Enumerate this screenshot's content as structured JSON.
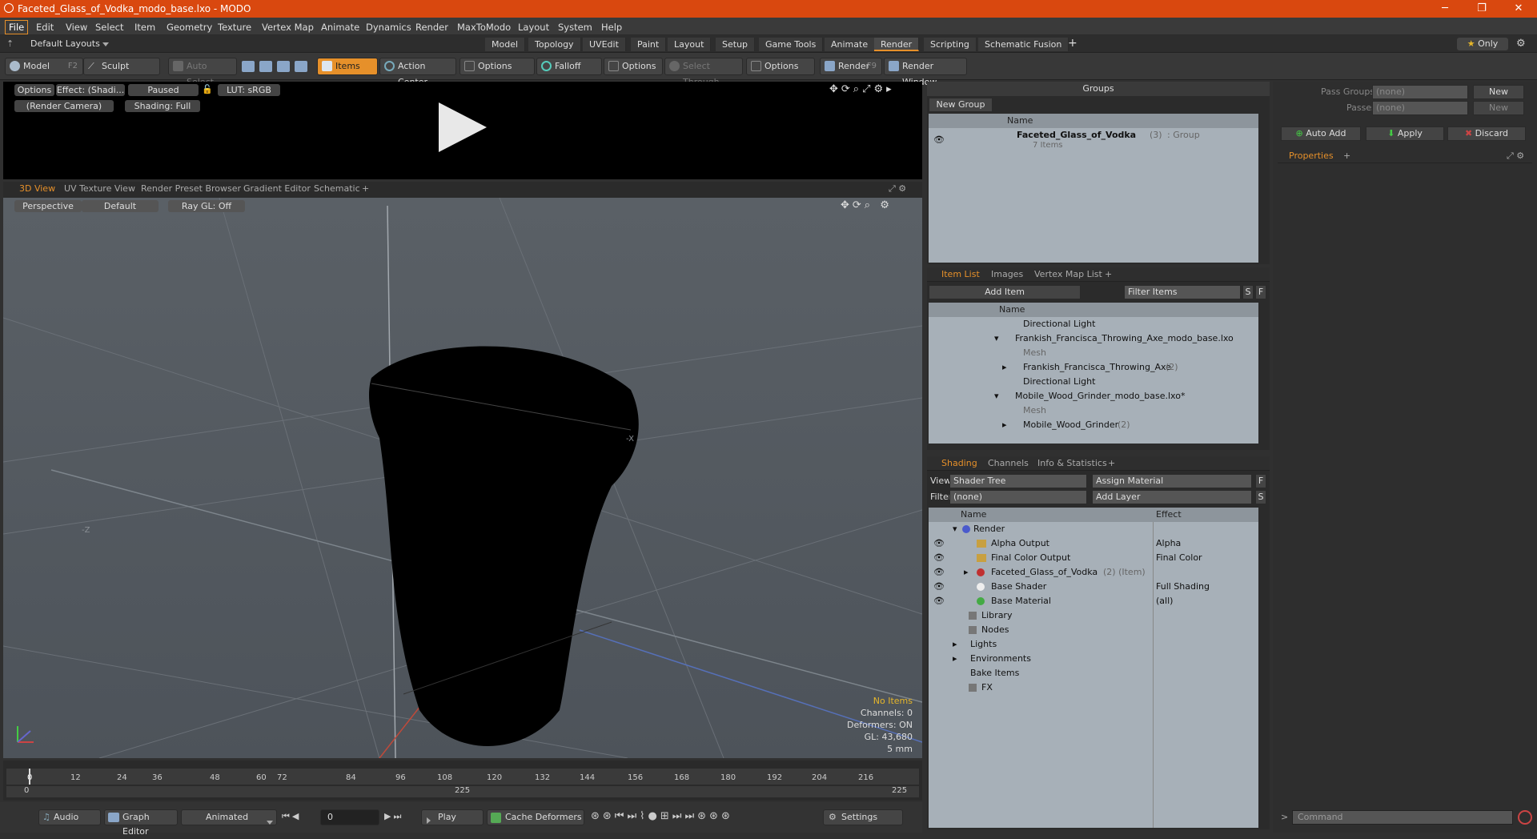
{
  "window": {
    "title": "Faceted_Glass_of_Vodka_modo_base.lxo - MODO"
  },
  "menu": [
    "File",
    "Edit",
    "View",
    "Select",
    "Item",
    "Geometry",
    "Texture",
    "Vertex Map",
    "Animate",
    "Dynamics",
    "Render",
    "MaxToModo",
    "Layout",
    "System",
    "Help"
  ],
  "layout_selector": "Default Layouts",
  "layout_tabs": [
    "Model",
    "Topology",
    "UVEdit",
    "Paint",
    "Layout",
    "Setup",
    "Game Tools",
    "Animate",
    "Render",
    "Scripting",
    "Schematic Fusion"
  ],
  "layout_tab_add": "+",
  "only_label": "Only",
  "toolbar": {
    "model": "Model",
    "model_key": "F2",
    "sculpt": "Sculpt",
    "auto_select": "Auto Select",
    "items": "Items",
    "action_center": "Action Center",
    "options1": "Options",
    "falloff": "Falloff",
    "options2": "Options",
    "select_through": "Select Through",
    "options3": "Options",
    "render": "Render",
    "render_key": "F9",
    "render_window": "Render Window"
  },
  "preview": {
    "options": "Options",
    "effect": "Effect: (Shadi...",
    "paused": "Paused",
    "lut": "LUT: sRGB",
    "camera": "(Render Camera)",
    "shading": "Shading: Full"
  },
  "viewport_tabs": [
    "3D View",
    "UV Texture View",
    "Render Preset Browser",
    "Gradient Editor",
    "Schematic",
    "+"
  ],
  "viewport": {
    "perspective": "Perspective",
    "default": "Default",
    "raygl": "Ray GL: Off",
    "axis_x_label": "-X",
    "axis_z_label": "-Z"
  },
  "status": {
    "no_items": "No Items",
    "channels": "Channels: 0",
    "deformers": "Deformers: ON",
    "gl": "GL: 43,680",
    "unit": "5 mm"
  },
  "timeline": {
    "ticks": [
      "0",
      "12",
      "24",
      "36",
      "48",
      "60",
      "72",
      "84",
      "96",
      "108",
      "120",
      "132",
      "144",
      "156",
      "168",
      "180",
      "192",
      "204",
      "216"
    ],
    "range_start": "0",
    "range_mid": "225",
    "range_end": "225"
  },
  "bottom": {
    "audio": "Audio",
    "graph_editor": "Graph Editor",
    "animated": "Animated",
    "frame": "0",
    "play": "Play",
    "cache_deformers": "Cache Deformers",
    "settings": "Settings"
  },
  "groups": {
    "title": "Groups",
    "new_group": "New Group",
    "col_name": "Name",
    "item_name": "Faceted_Glass_of_Vodka",
    "item_count": "(3)",
    "item_type": ": Group",
    "item_sub": "7 Items"
  },
  "itemlist": {
    "tabs": [
      "Item List",
      "Images",
      "Vertex Map List",
      "+"
    ],
    "add_item": "Add Item",
    "filter": "Filter Items",
    "s": "S",
    "f": "F",
    "col_name": "Name",
    "rows": [
      {
        "label": "Directional Light",
        "dim": false
      },
      {
        "label": "Frankish_Francisca_Throwing_Axe_modo_base.lxo",
        "dim": false
      },
      {
        "label": "Mesh",
        "dim": true
      },
      {
        "label": "Frankish_Francisca_Throwing_Axe",
        "suffix": "(2)",
        "dim": false
      },
      {
        "label": "Directional Light",
        "dim": false
      },
      {
        "label": "Mobile_Wood_Grinder_modo_base.lxo*",
        "dim": false
      },
      {
        "label": "Mesh",
        "dim": true
      },
      {
        "label": "Mobile_Wood_Grinder",
        "suffix": "(2)",
        "dim": false
      }
    ]
  },
  "shading": {
    "tabs": [
      "Shading",
      "Channels",
      "Info & Statistics",
      "+"
    ],
    "view_label": "View",
    "view_value": "Shader Tree",
    "assign_material": "Assign Material",
    "f": "F",
    "filter_label": "Filter",
    "filter_value": "(none)",
    "add_layer": "Add Layer",
    "s": "S",
    "col_name": "Name",
    "col_effect": "Effect",
    "rows": [
      {
        "label": "Render",
        "effect": ""
      },
      {
        "label": "Alpha Output",
        "effect": "Alpha"
      },
      {
        "label": "Final Color Output",
        "effect": "Final Color"
      },
      {
        "label": "Faceted_Glass_of_Vodka",
        "suffix": "(2) (Item)",
        "effect": ""
      },
      {
        "label": "Base Shader",
        "effect": "Full Shading"
      },
      {
        "label": "Base Material",
        "effect": "(all)"
      },
      {
        "label": "Library",
        "effect": ""
      },
      {
        "label": "Nodes",
        "effect": ""
      },
      {
        "label": "Lights",
        "effect": ""
      },
      {
        "label": "Environments",
        "effect": ""
      },
      {
        "label": "Bake Items",
        "effect": ""
      },
      {
        "label": "FX",
        "effect": ""
      }
    ]
  },
  "passes": {
    "pass_groups": "Pass Groups",
    "passes": "Passes",
    "none1": "(none)",
    "none2": "(none)",
    "new1": "New",
    "new2": "New"
  },
  "actions": {
    "auto_add": "Auto Add",
    "apply": "Apply",
    "discard": "Discard"
  },
  "properties": {
    "tab": "Properties",
    "add": "+"
  },
  "command": {
    "placeholder": "Command"
  }
}
